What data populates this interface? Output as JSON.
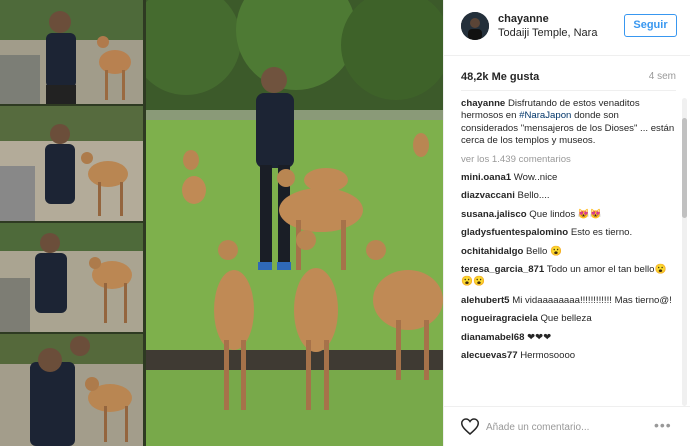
{
  "post": {
    "username": "chayanne",
    "location": "Todaiji Temple, Nara",
    "follow_label": "Seguir",
    "likes": "48,2k Me gusta",
    "time_ago": "4 sem",
    "caption_user": "chayanne",
    "caption_text_1": "Disfrutando de estos venaditos hermosos en ",
    "caption_hashtag": "#NaraJapon",
    "caption_text_2": " donde son considerados \"mensajeros de los Dioses\" ... están cerca de los templos y museos.",
    "view_all": "ver los 1.439 comentarios",
    "comment_placeholder": "Añade un comentario...",
    "more_label": "•••"
  },
  "comments": [
    {
      "user": "mini.oana1",
      "text": "Wow..nice"
    },
    {
      "user": "diazvaccani",
      "text": "Bello...."
    },
    {
      "user": "susana.jalisco",
      "text": "Que lindos 😻😻"
    },
    {
      "user": "gladysfuentespalomino",
      "text": "Esto es tierno."
    },
    {
      "user": "ochitahidalgo",
      "text": "Bello 😮"
    },
    {
      "user": "teresa_garcia_871",
      "text": "Todo un amor el tan bello😮😮😮"
    },
    {
      "user": "alehubert5",
      "text": "Mi vidaaaaaaaa!!!!!!!!!!!! Mas tierno@!"
    },
    {
      "user": "nogueiragraciela",
      "text": "Que belleza"
    },
    {
      "user": "dianamabel68",
      "text": "❤❤❤"
    },
    {
      "user": "alecuevas77",
      "text": "Hermosoooo"
    }
  ],
  "colors": {
    "accent": "#3897f0",
    "hashtag": "#003569",
    "muted": "#999999",
    "text": "#262626"
  },
  "icons": {
    "like": "heart-icon",
    "more": "more-options-icon"
  }
}
